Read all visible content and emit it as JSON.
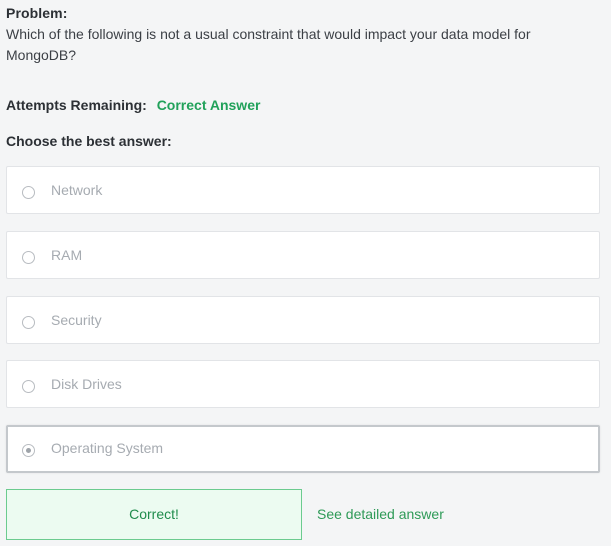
{
  "problem": {
    "title": "Problem:",
    "text": "Which of the following is not a usual constraint that would impact your data model for MongoDB?"
  },
  "attempts": {
    "label": "Attempts Remaining:",
    "value": "Correct Answer"
  },
  "choose_label": "Choose the best answer:",
  "options": [
    {
      "label": "Network",
      "selected": false
    },
    {
      "label": "RAM",
      "selected": false
    },
    {
      "label": "Security",
      "selected": false
    },
    {
      "label": "Disk Drives",
      "selected": false
    },
    {
      "label": "Operating System",
      "selected": true
    }
  ],
  "feedback": {
    "result": "Correct!",
    "detail_link": "See detailed answer"
  },
  "colors": {
    "success_green": "#21a15a",
    "feedback_bg": "#ecfbf1",
    "feedback_border": "#6ccb8f",
    "page_bg": "#f4f5f6"
  },
  "icons": {
    "radio": "radio-button-icon"
  }
}
